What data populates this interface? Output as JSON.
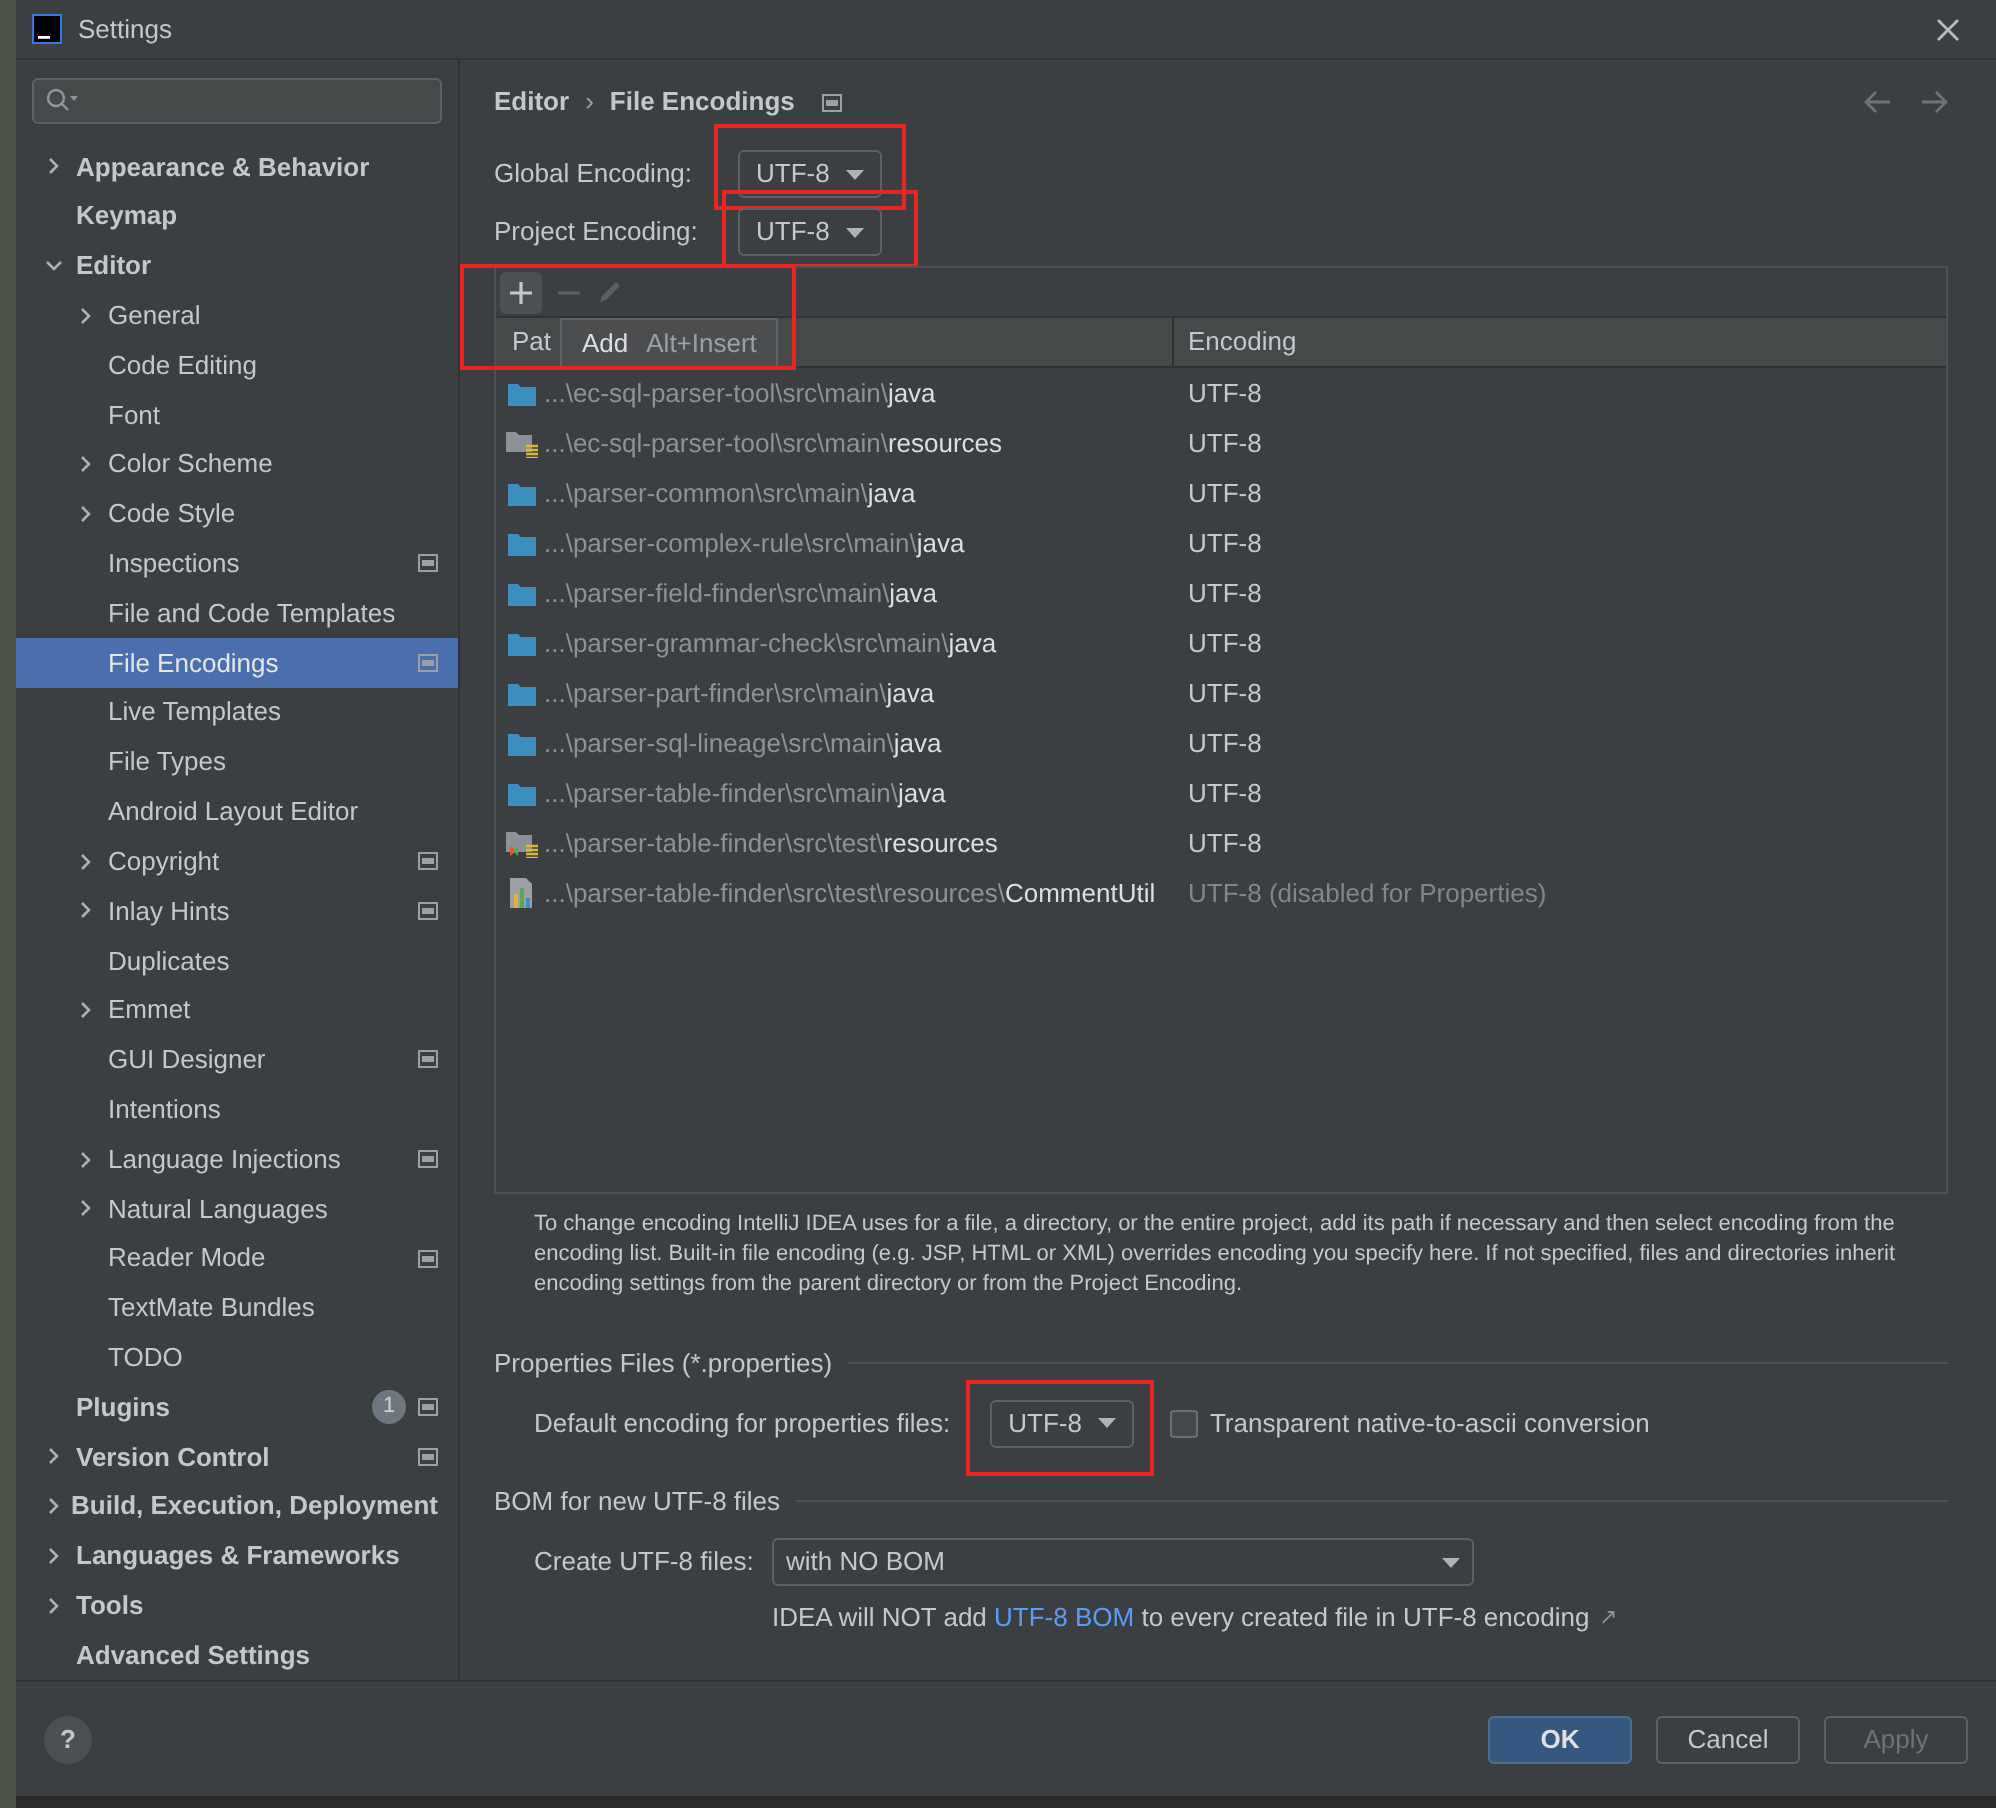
{
  "window": {
    "title": "Settings"
  },
  "sidebar": {
    "items": [
      {
        "label": "Appearance & Behavior",
        "expanded": false
      },
      {
        "label": "Keymap"
      },
      {
        "label": "Editor",
        "expanded": true,
        "children": [
          {
            "label": "General",
            "expanded": false
          },
          {
            "label": "Code Editing"
          },
          {
            "label": "Font"
          },
          {
            "label": "Color Scheme",
            "expanded": false
          },
          {
            "label": "Code Style",
            "expanded": false
          },
          {
            "label": "Inspections",
            "project_scoped": true
          },
          {
            "label": "File and Code Templates"
          },
          {
            "label": "File Encodings",
            "project_scoped": true,
            "selected": true
          },
          {
            "label": "Live Templates"
          },
          {
            "label": "File Types"
          },
          {
            "label": "Android Layout Editor"
          },
          {
            "label": "Copyright",
            "expanded": false,
            "project_scoped": true
          },
          {
            "label": "Inlay Hints",
            "expanded": false,
            "project_scoped": true
          },
          {
            "label": "Duplicates"
          },
          {
            "label": "Emmet",
            "expanded": false
          },
          {
            "label": "GUI Designer",
            "project_scoped": true
          },
          {
            "label": "Intentions"
          },
          {
            "label": "Language Injections",
            "expanded": false,
            "project_scoped": true
          },
          {
            "label": "Natural Languages",
            "expanded": false
          },
          {
            "label": "Reader Mode",
            "project_scoped": true
          },
          {
            "label": "TextMate Bundles"
          },
          {
            "label": "TODO"
          }
        ]
      },
      {
        "label": "Plugins",
        "badge": "1",
        "project_scoped": true
      },
      {
        "label": "Version Control",
        "expanded": false,
        "project_scoped": true
      },
      {
        "label": "Build, Execution, Deployment",
        "expanded": false
      },
      {
        "label": "Languages & Frameworks",
        "expanded": false
      },
      {
        "label": "Tools",
        "expanded": false
      },
      {
        "label": "Advanced Settings"
      }
    ]
  },
  "breadcrumb": {
    "parent": "Editor",
    "separator": "›",
    "current": "File Encodings"
  },
  "global_encoding": {
    "label": "Global Encoding:",
    "value": "UTF-8",
    "highlighted": true
  },
  "project_encoding": {
    "label": "Project Encoding:",
    "value": "UTF-8",
    "highlighted": true
  },
  "toolbar": {
    "highlighted": true,
    "tooltip": {
      "label": "Add",
      "shortcut": "Alt+Insert"
    }
  },
  "table": {
    "columns": [
      "Pat",
      "Encoding"
    ],
    "rows": [
      {
        "kind": "folder",
        "prefix": "...\\ec-sql-parser-tool\\src\\main\\",
        "tail": "java",
        "encoding": "UTF-8",
        "disabled": false
      },
      {
        "kind": "resources",
        "prefix": "...\\ec-sql-parser-tool\\src\\main\\",
        "tail": "resources",
        "encoding": "UTF-8",
        "disabled": false
      },
      {
        "kind": "folder",
        "prefix": "...\\parser-common\\src\\main\\",
        "tail": "java",
        "encoding": "UTF-8",
        "disabled": false
      },
      {
        "kind": "folder",
        "prefix": "...\\parser-complex-rule\\src\\main\\",
        "tail": "java",
        "encoding": "UTF-8",
        "disabled": false
      },
      {
        "kind": "folder",
        "prefix": "...\\parser-field-finder\\src\\main\\",
        "tail": "java",
        "encoding": "UTF-8",
        "disabled": false
      },
      {
        "kind": "folder",
        "prefix": "...\\parser-grammar-check\\src\\main\\",
        "tail": "java",
        "encoding": "UTF-8",
        "disabled": false
      },
      {
        "kind": "folder",
        "prefix": "...\\parser-part-finder\\src\\main\\",
        "tail": "java",
        "encoding": "UTF-8",
        "disabled": false
      },
      {
        "kind": "folder",
        "prefix": "...\\parser-sql-lineage\\src\\main\\",
        "tail": "java",
        "encoding": "UTF-8",
        "disabled": false
      },
      {
        "kind": "folder",
        "prefix": "...\\parser-table-finder\\src\\main\\",
        "tail": "java",
        "encoding": "UTF-8",
        "disabled": false
      },
      {
        "kind": "test_resources",
        "prefix": "...\\parser-table-finder\\src\\test\\",
        "tail": "resources",
        "encoding": "UTF-8",
        "disabled": false
      },
      {
        "kind": "properties_file",
        "prefix": "...\\parser-table-finder\\src\\test\\resources\\",
        "tail": "CommentUtil",
        "encoding": "UTF-8 (disabled for Properties)",
        "disabled": true
      }
    ]
  },
  "description": "To change encoding IntelliJ IDEA uses for a file, a directory, or the entire project, add its path if necessary and then select encoding from the encoding list. Built-in file encoding (e.g. JSP, HTML or XML) overrides encoding you specify here. If not specified, files and directories inherit encoding settings from the parent directory or from the Project Encoding.",
  "properties_section": {
    "title": "Properties Files (*.properties)",
    "default_label": "Default encoding for properties files:",
    "default_value": "UTF-8",
    "highlighted": true,
    "transparent": {
      "label": "Transparent native-to-ascii conversion",
      "checked": false
    }
  },
  "bom_section": {
    "title": "BOM for new UTF-8 files",
    "create_label": "Create UTF-8 files:",
    "create_value": "with NO BOM",
    "note_before": "IDEA will NOT add ",
    "note_link": "UTF-8 BOM",
    "note_after": " to every created file in UTF-8 encoding",
    "note_arrow": "↗"
  },
  "help": {
    "label": "?"
  },
  "buttons": [
    {
      "label": "OK",
      "kind": "primary",
      "disabled": false
    },
    {
      "label": "Cancel",
      "kind": "normal",
      "disabled": false
    },
    {
      "label": "Apply",
      "kind": "normal",
      "disabled": true
    }
  ]
}
